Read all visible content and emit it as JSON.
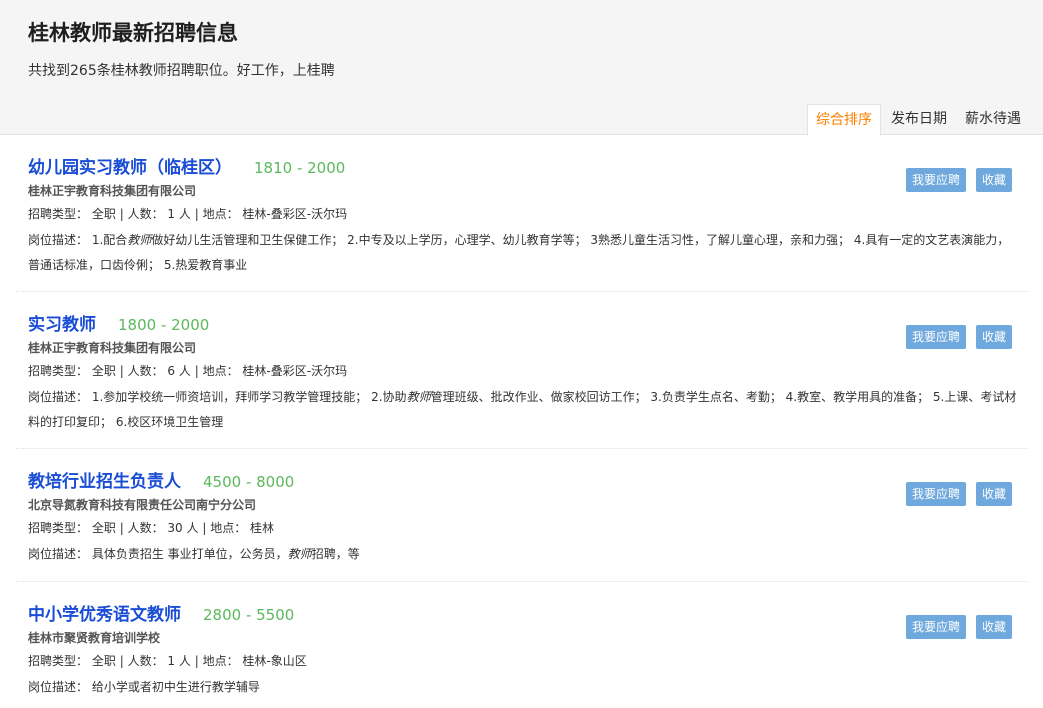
{
  "header": {
    "title": "桂林教师最新招聘信息",
    "subtitle": "共找到265条桂林教师招聘职位。好工作，上桂聘"
  },
  "sort_tabs": [
    {
      "label": "综合排序",
      "active": true
    },
    {
      "label": "发布日期",
      "active": false
    },
    {
      "label": "薪水待遇",
      "active": false
    }
  ],
  "labels": {
    "type": "招聘类型：",
    "count": "人数：",
    "location": "地点：",
    "desc": "岗位描述：",
    "sep": "|",
    "apply": "我要应聘",
    "save": "收藏"
  },
  "jobs": [
    {
      "title": "幼儿园实习教师（临桂区）",
      "salary": "1810 - 2000",
      "company": "桂林正宇教育科技集团有限公司",
      "type": "全职",
      "count": "1 人",
      "location": "桂林-叠彩区-沃尔玛",
      "desc_parts": [
        "1.配合",
        "教师",
        "做好幼儿生活管理和卫生保健工作； 2.中专及以上学历，心理学、幼儿教育学等； 3熟悉儿童生活习性，了解儿童心理，亲和力强； 4.具有一定的文艺表演能力，普通话标准，口齿伶俐； 5.热爱教育事业"
      ]
    },
    {
      "title": "实习教师",
      "salary": "1800 - 2000",
      "company": "桂林正宇教育科技集团有限公司",
      "type": "全职",
      "count": "6 人",
      "location": "桂林-叠彩区-沃尔玛",
      "desc_parts": [
        "1.参加学校统一师资培训，拜师学习教学管理技能； 2.协助",
        "教师",
        "管理班级、批改作业、做家校回访工作； 3.负责学生点名、考勤； 4.教室、教学用具的准备； 5.上课、考试材料的打印复印； 6.校区环境卫生管理"
      ]
    },
    {
      "title": "教培行业招生负责人",
      "salary": "4500 - 8000",
      "company": "北京导氮教育科技有限责任公司南宁分公司",
      "type": "全职",
      "count": "30 人",
      "location": "桂林",
      "desc_parts": [
        "具体负责招生 事业打单位，公务员，",
        "教师",
        "招聘，等"
      ]
    },
    {
      "title": "中小学优秀语文教师",
      "salary": "2800 - 5500",
      "company": "桂林市聚贤教育培训学校",
      "type": "全职",
      "count": "1 人",
      "location": "桂林-象山区",
      "desc_parts": [
        "给小学或者初中生进行教学辅导",
        "",
        ""
      ]
    }
  ]
}
